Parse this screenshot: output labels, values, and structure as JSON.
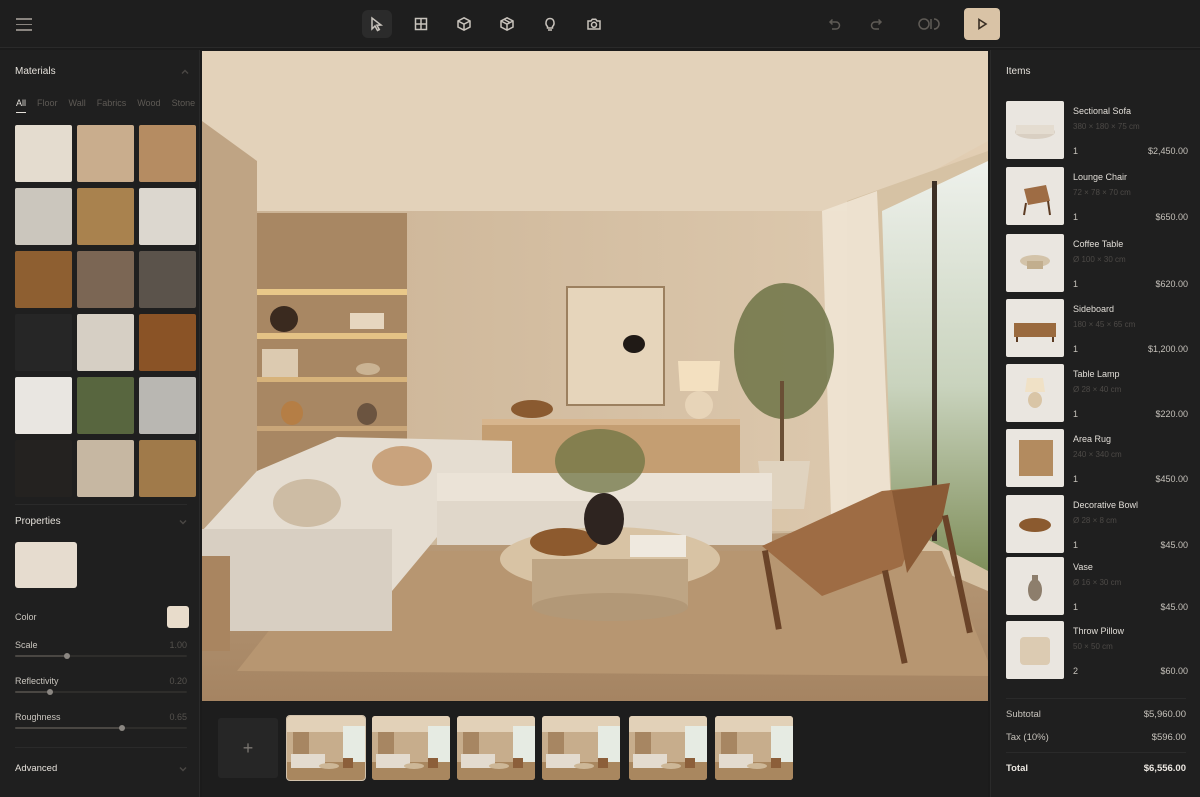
{
  "toolbar": {
    "tools": [
      "select-tool",
      "layout-tool",
      "object-tool",
      "3d-view-tool",
      "lighting-tool",
      "camera-tool"
    ],
    "accent": "#d9c3a6"
  },
  "materials": {
    "title": "Materials",
    "tabs": [
      "All",
      "Floor",
      "Wall",
      "Fabrics",
      "Wood",
      "Stone"
    ],
    "active_tab": "All",
    "swatches": [
      "#e4dccf",
      "#c9ad8d",
      "#b58c62",
      "#cbc6bd",
      "#a9824e",
      "#dcd7cf",
      "#8e5f31",
      "#7b6654",
      "#5b534b",
      "#262626",
      "#d6cfc4",
      "#8a5326",
      "#e9e6e1",
      "#58663f",
      "#b9b7b2",
      "#242220",
      "#c6b7a2",
      "#a07a4a"
    ]
  },
  "properties": {
    "title": "Properties",
    "color_label": "Color",
    "color_value": "#e8dccb",
    "scale_label": "Scale",
    "scale_value": "1.00",
    "reflectivity_label": "Reflectivity",
    "reflectivity_value": "0.20",
    "roughness_label": "Roughness",
    "roughness_value": "0.65",
    "advanced_label": "Advanced"
  },
  "strip": {
    "add_label": "+"
  },
  "items": {
    "title": "Items",
    "list": [
      {
        "name": "Sectional Sofa",
        "dims": "380 × 180 × 75 cm",
        "qty": "1",
        "price": "$2,450.00"
      },
      {
        "name": "Lounge Chair",
        "dims": "72 × 78 × 70 cm",
        "qty": "1",
        "price": "$650.00"
      },
      {
        "name": "Coffee Table",
        "dims": "Ø 100 × 30 cm",
        "qty": "1",
        "price": "$620.00"
      },
      {
        "name": "Sideboard",
        "dims": "180 × 45 × 65 cm",
        "qty": "1",
        "price": "$1,200.00"
      },
      {
        "name": "Table Lamp",
        "dims": "Ø 28 × 40 cm",
        "qty": "1",
        "price": "$220.00"
      },
      {
        "name": "Area Rug",
        "dims": "240 × 340 cm",
        "qty": "1",
        "price": "$450.00"
      },
      {
        "name": "Decorative Bowl",
        "dims": "Ø 28 × 8 cm",
        "qty": "1",
        "price": "$45.00"
      },
      {
        "name": "Vase",
        "dims": "Ø 16 × 30 cm",
        "qty": "1",
        "price": "$45.00"
      },
      {
        "name": "Throw Pillow",
        "dims": "50 × 50 cm",
        "qty": "2",
        "price": "$60.00"
      }
    ],
    "subtotal_label": "Subtotal",
    "subtotal": "$5,960.00",
    "tax_label": "Tax (10%)",
    "tax": "$596.00",
    "total_label": "Total",
    "total": "$6,556.00"
  }
}
